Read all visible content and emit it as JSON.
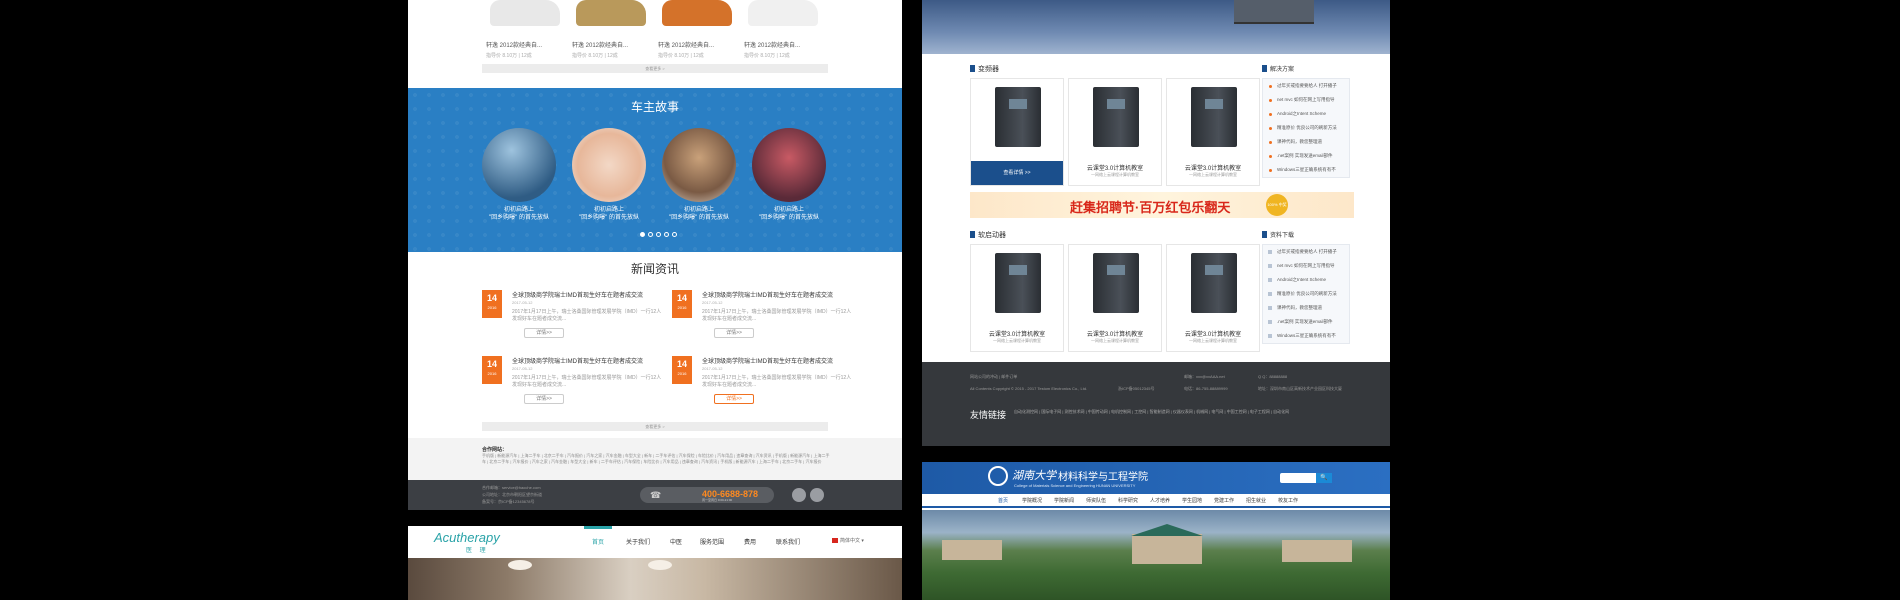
{
  "left": {
    "cars": [
      {
        "title": "轩逸 2012款经典自...",
        "sub": "指导价 8.10万 | 12成"
      },
      {
        "title": "轩逸 2012款经典自...",
        "sub": "指导价 8.10万 | 12成"
      },
      {
        "title": "轩逸 2012款经典自...",
        "sub": "指导价 8.10万 | 12成"
      },
      {
        "title": "轩逸 2012款经典自...",
        "sub": "指导价 8.10万 | 12成"
      }
    ],
    "colors": {
      "car1": "#e8e8e8",
      "car2": "#b9995b",
      "car3": "#d4722a",
      "car4": "#f0f0f0"
    },
    "more_label": "查看更多 >",
    "story": {
      "title": "车主故事",
      "items": [
        {
          "l1": "初初启路上",
          "l2": "\"回乡购曝\" 的首先放纵"
        },
        {
          "l1": "初初启路上",
          "l2": "\"回乡购曝\" 的首先放纵"
        },
        {
          "l1": "初初启路上",
          "l2": "\"回乡购曝\" 的首先放纵"
        },
        {
          "l1": "初初启路上",
          "l2": "\"回乡购曝\" 的首先放纵"
        }
      ]
    },
    "news": {
      "title": "新闻资讯",
      "items": [
        {
          "day": "14",
          "ym": "2016",
          "h": "全球顶级商学院瑞士IMD首现生好车在题者成交流",
          "d": "2017-05-12",
          "p": "2017年1月17日上午，瑞士洛桑国际管理发展学院（IMD）一行12人发现好车在题者成交流...",
          "btn": "详情>>"
        },
        {
          "day": "14",
          "ym": "2016",
          "h": "全球顶级商学院瑞士IMD首现生好车在题者成交流",
          "d": "2017-05-12",
          "p": "2017年1月17日上午，瑞士洛桑国际管理发展学院（IMD）一行12人发现好车在题者成交流...",
          "btn": "详情>>"
        },
        {
          "day": "14",
          "ym": "2016",
          "h": "全球顶级商学院瑞士IMD首现生好车在题者成交流",
          "d": "2017-05-12",
          "p": "2017年1月17日上午，瑞士洛桑国际管理发展学院（IMD）一行12人发现好车在题者成交流...",
          "btn": "详情>>"
        },
        {
          "day": "14",
          "ym": "2016",
          "h": "全球顶级商学院瑞士IMD首现生好车在题者成交流",
          "d": "2017-05-12",
          "p": "2017年1月17日上午，瑞士洛桑国际管理发展学院（IMD）一行12人发现好车在题者成交流...",
          "btn": "详情>>"
        }
      ]
    },
    "partners": {
      "title": "合作网站：",
      "links": "手机版 | 新能源汽车 | 上海二手车 | 北京二手车 | 汽车报价 | 汽车之家 | 汽车金融 | 车型大全 | 新车 | 二手车评估 | 汽车保险 | 车险比价 | 汽车用品 | 违章查询 | 汽车资讯 | 手机版 | 新能源汽车 | 上海二手车 | 北京二手车 | 汽车报价 | 汽车之家 | 汽车金融 | 车型大全 | 新车 | 二手车评估 | 汽车保险 | 车险比价 | 汽车用品 | 违章查询 | 汽车资讯 | 手机版 | 新能源汽车 | 上海二手车 | 北京二手车 | 汽车报价"
    },
    "footer": {
      "l1": "合作邮箱：service@haoche.com",
      "l2": "公司地址：北京市朝阳区望京街道",
      "l3": "备案号：京ICP备12345678号",
      "hotline": "400-6688-878",
      "hotline_sub": "周一至周日 9:00-21:00"
    }
  },
  "acu": {
    "logo": "Acutherapy",
    "logo_cn": "医 理",
    "nav": [
      "首页",
      "关于我们",
      "中医",
      "服务范围",
      "费用",
      "联系我们"
    ],
    "lang": "简体中文 ▾"
  },
  "right": {
    "sec1": "变频器",
    "sec2": "软启动器",
    "side1_title": "解决方案",
    "side2_title": "资料下载",
    "products1": [
      {
        "t": "",
        "s": "",
        "btn": "查看详情 >>"
      },
      {
        "t": "云课堂3.0计算机教室",
        "s": "一网络上云课程计算机教室"
      },
      {
        "t": "云课堂3.0计算机教室",
        "s": "一网络上云课程计算机教室"
      }
    ],
    "products2": [
      {
        "t": "云课堂3.0计算机教室",
        "s": "一网络上云课程计算机教室"
      },
      {
        "t": "云课堂3.0计算机教室",
        "s": "一网络上云课程计算机教室"
      },
      {
        "t": "云课堂3.0计算机教室",
        "s": "一网络上云课程计算机教室"
      }
    ],
    "side_items": [
      "过年买戒指要要给人 打开播子",
      "net mvc 如何在网上写用指导",
      "Android之Intent Scheme",
      "精准原价 优良公司的刷新方法",
      "课神代码，教您整理道",
      ".net案例 实现发送email部件",
      "Windows三星正确系统有有不"
    ],
    "banner": "赶集招聘节·百万红包乐翻天",
    "banner_badge": "100% 中奖",
    "footer": {
      "a": "网站公司的冲动 | 邮件订单",
      "b": "All Contents Copyright © 2015 - 2017 Testom Electronics Co., Ltd.",
      "c": "浙ICP备05012345号",
      "mail": "邮箱：xxx@xxAAA.net",
      "qq": "Q Q：88888888",
      "tel": "电话：86-755-88889999",
      "addr": "地址：深圳市南山区高新技术产业园区科技大厦",
      "friend": "友情链接",
      "friend_links": "自动化测控网 | 国际电子网 | 测控技术网 | 中国传动网 | 电机控制网 | 工控网 | 智能制造网 | 仪器仪表网 | 机械网 | 电气网 | 中国工控网 | 电子工程网 | 自动化网"
    }
  },
  "hunan": {
    "name": "湖南大学",
    "school": "材料科学与工程学院",
    "en": "College of Materials Science and Engineering   HUNAN UNIVERSITY",
    "search_btn": "🔍",
    "nav": [
      "首页",
      "学院概况",
      "学院新闻",
      "师资队伍",
      "科学研究",
      "人才培养",
      "学生园地",
      "党建工作",
      "招生就业",
      "校友工作"
    ]
  }
}
